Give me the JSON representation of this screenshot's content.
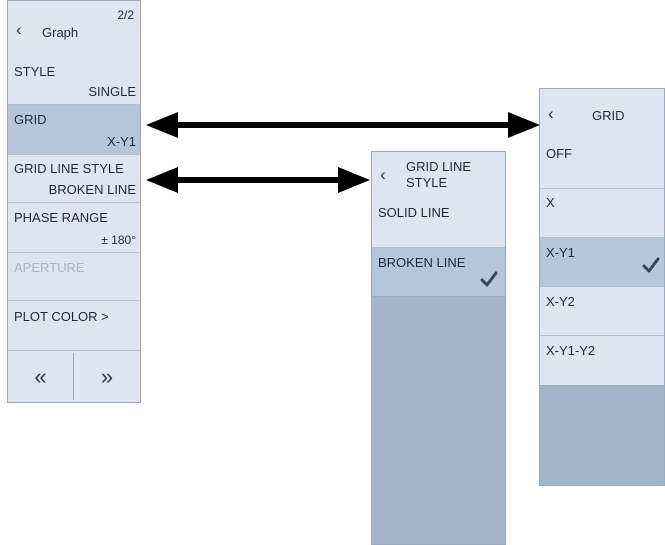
{
  "left_panel": {
    "back_icon": "chevron-left-icon",
    "title": "Graph",
    "page": "2/2",
    "items": [
      {
        "label": "STYLE",
        "value": "SINGLE"
      },
      {
        "label": "GRID",
        "value": "X-Y1"
      },
      {
        "label": "GRID LINE STYLE",
        "value": "BROKEN LINE"
      },
      {
        "label": "PHASE RANGE",
        "value": "± 180°"
      },
      {
        "label": "APERTURE",
        "value": ""
      },
      {
        "label": "PLOT COLOR >",
        "value": ""
      }
    ],
    "prev_label": "«",
    "next_label": "»"
  },
  "mid_panel": {
    "back_icon": "chevron-left-icon",
    "title_line1": "GRID LINE",
    "title_line2": "STYLE",
    "options": [
      "SOLID LINE",
      "BROKEN LINE"
    ],
    "selected": "BROKEN LINE"
  },
  "right_panel": {
    "back_icon": "chevron-left-icon",
    "title": "GRID",
    "options": [
      "OFF",
      "X",
      "X-Y1",
      "X-Y2",
      "X-Y1-Y2"
    ],
    "selected": "X-Y1"
  },
  "colors": {
    "panel": "#dde6f0",
    "selected": "#b6c6da",
    "empty": "#a5b4c9",
    "arrow": "#000000"
  }
}
